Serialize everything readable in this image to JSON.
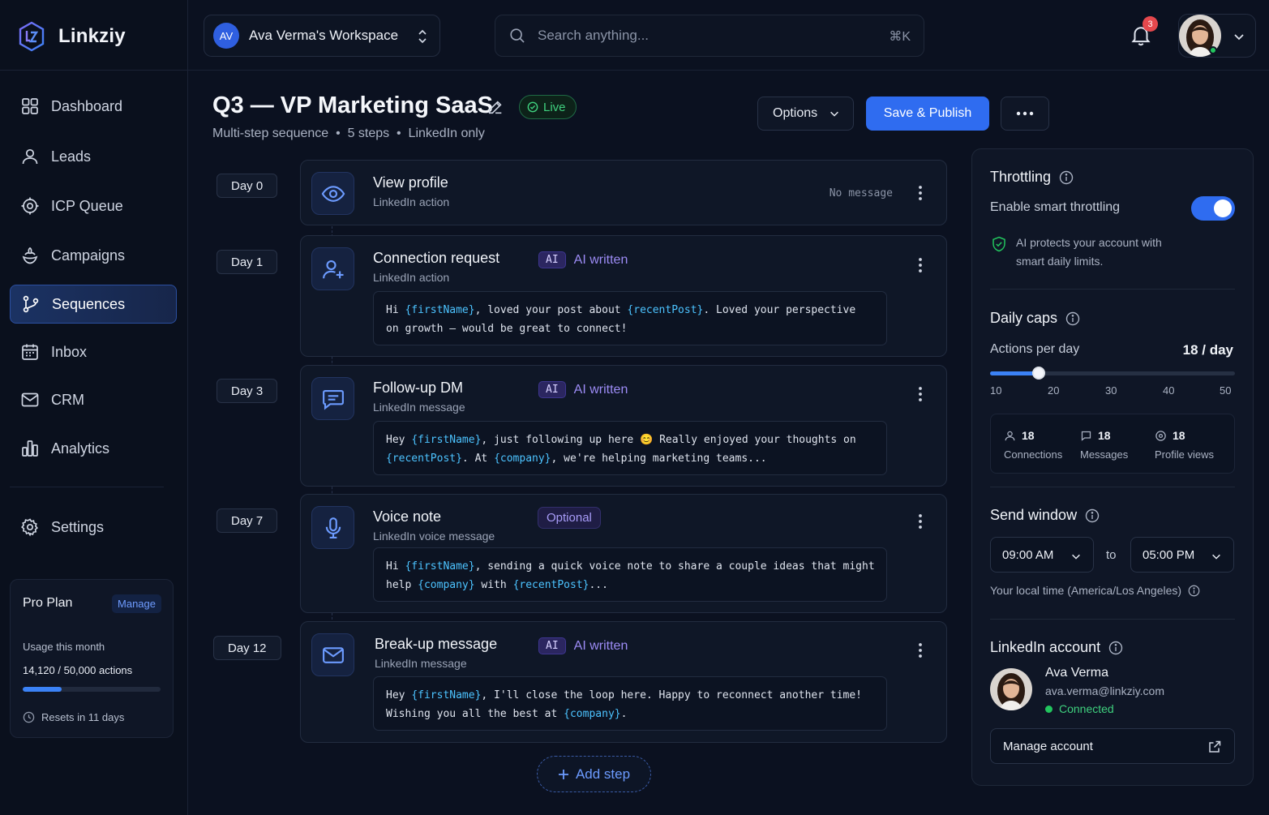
{
  "app": {
    "name": "Linkziy"
  },
  "workspace": {
    "initials": "AV",
    "name": "Ava Verma's Workspace"
  },
  "search": {
    "placeholder": "Search anything...",
    "shortcut": "⌘K"
  },
  "notifications": {
    "count": "3"
  },
  "nav": {
    "items": [
      {
        "label": "Dashboard",
        "icon": "grid-icon"
      },
      {
        "label": "Leads",
        "icon": "user-icon"
      },
      {
        "label": "ICP Queue",
        "icon": "target-icon"
      },
      {
        "label": "Campaigns",
        "icon": "megaphone-icon"
      },
      {
        "label": "Sequences",
        "icon": "branch-icon",
        "active": true
      },
      {
        "label": "Inbox",
        "icon": "calendar-icon"
      },
      {
        "label": "CRM",
        "icon": "mail-icon"
      },
      {
        "label": "Analytics",
        "icon": "bar-chart-icon"
      }
    ],
    "settings": "Settings"
  },
  "plan": {
    "title": "Pro Plan",
    "manage": "Manage",
    "usage_label": "Usage this month",
    "usage_value": "14,120 / 50,000 actions",
    "usage_fraction": 0.2824,
    "reset": "Resets in 11 days"
  },
  "header": {
    "title": "Q3 — VP Marketing SaaS",
    "status": "Live",
    "subtitle": "Multi-step sequence  •  5 steps  •  LinkedIn only",
    "options": "Options",
    "publish": "Save & Publish"
  },
  "steps": [
    {
      "day": "Day 0",
      "title": "View profile",
      "sub": "LinkedIn action",
      "note": "No message",
      "icon": "eye-icon"
    },
    {
      "day": "Day 1",
      "title": "Connection request",
      "sub": "LinkedIn action",
      "tag": "AI written",
      "chip": "AI",
      "icon": "user-plus-icon",
      "message": [
        [
          {
            "t": "Hi "
          },
          {
            "v": "{firstName}"
          },
          {
            "t": ", loved your post about "
          },
          {
            "v": "{recentPost}"
          },
          {
            "t": ". Loved your perspective"
          }
        ],
        [
          {
            "t": "on growth — would be great to connect!"
          }
        ]
      ]
    },
    {
      "day": "Day 3",
      "title": "Follow-up DM",
      "sub": "LinkedIn message",
      "tag": "AI written",
      "chip": "AI",
      "icon": "chat-icon",
      "message": [
        [
          {
            "t": "Hey "
          },
          {
            "v": "{firstName}"
          },
          {
            "t": ", just following up here 😊 Really enjoyed your thoughts on"
          }
        ],
        [
          {
            "v": "{recentPost}"
          },
          {
            "t": ". At "
          },
          {
            "v": "{company}"
          },
          {
            "t": ", we're helping marketing teams..."
          }
        ]
      ]
    },
    {
      "day": "Day 7",
      "title": "Voice note",
      "sub": "LinkedIn voice message",
      "optional": "Optional",
      "icon": "microphone-icon",
      "message": [
        [
          {
            "t": "Hi "
          },
          {
            "v": "{firstName}"
          },
          {
            "t": ", sending a quick voice note to share a couple ideas that might"
          }
        ],
        [
          {
            "t": "help "
          },
          {
            "v": "{company}"
          },
          {
            "t": " with "
          },
          {
            "v": "{recentPost}"
          },
          {
            "t": "..."
          }
        ]
      ]
    },
    {
      "day": "Day 12",
      "title": "Break-up message",
      "sub": "LinkedIn message",
      "tag": "AI written",
      "chip": "AI",
      "icon": "envelope-icon",
      "message": [
        [
          {
            "t": "Hey "
          },
          {
            "v": "{firstName}"
          },
          {
            "t": ", I'll close the loop here. Happy to reconnect another time!"
          }
        ],
        [
          {
            "t": "Wishing you all the best at "
          },
          {
            "v": "{company}"
          },
          {
            "t": "."
          }
        ]
      ]
    }
  ],
  "add_step": "Add step",
  "panel": {
    "throttling": {
      "title": "Throttling",
      "toggle_label": "Enable smart throttling",
      "enabled": true,
      "note_line1": "AI protects your account with",
      "note_line2": "smart daily limits."
    },
    "daily_caps": {
      "title": "Daily caps",
      "actions_label": "Actions per day",
      "actions_value": "18 / day",
      "slider_value": 18,
      "slider_min": 10,
      "slider_max": 50,
      "ticks": [
        "10",
        "20",
        "30",
        "40",
        "50"
      ],
      "caps": [
        {
          "value": "18",
          "label": "Connections",
          "icon": "user-icon"
        },
        {
          "value": "18",
          "label": "Messages",
          "icon": "chat-icon"
        },
        {
          "value": "18",
          "label": "Profile views",
          "icon": "eye-icon"
        }
      ]
    },
    "send_window": {
      "title": "Send window",
      "from": "09:00 AM",
      "to_label": "to",
      "to": "05:00 PM",
      "timezone": "Your local time (America/Los Angeles)"
    },
    "linkedin": {
      "title": "LinkedIn account",
      "name": "Ava Verma",
      "email": "ava.verma@linkziy.com",
      "status": "Connected",
      "manage": "Manage account"
    }
  },
  "colors": {
    "accent": "#2f6cf0",
    "success": "#22c55e",
    "ai": "#9d8cf6",
    "variable": "#4cc3ff"
  }
}
